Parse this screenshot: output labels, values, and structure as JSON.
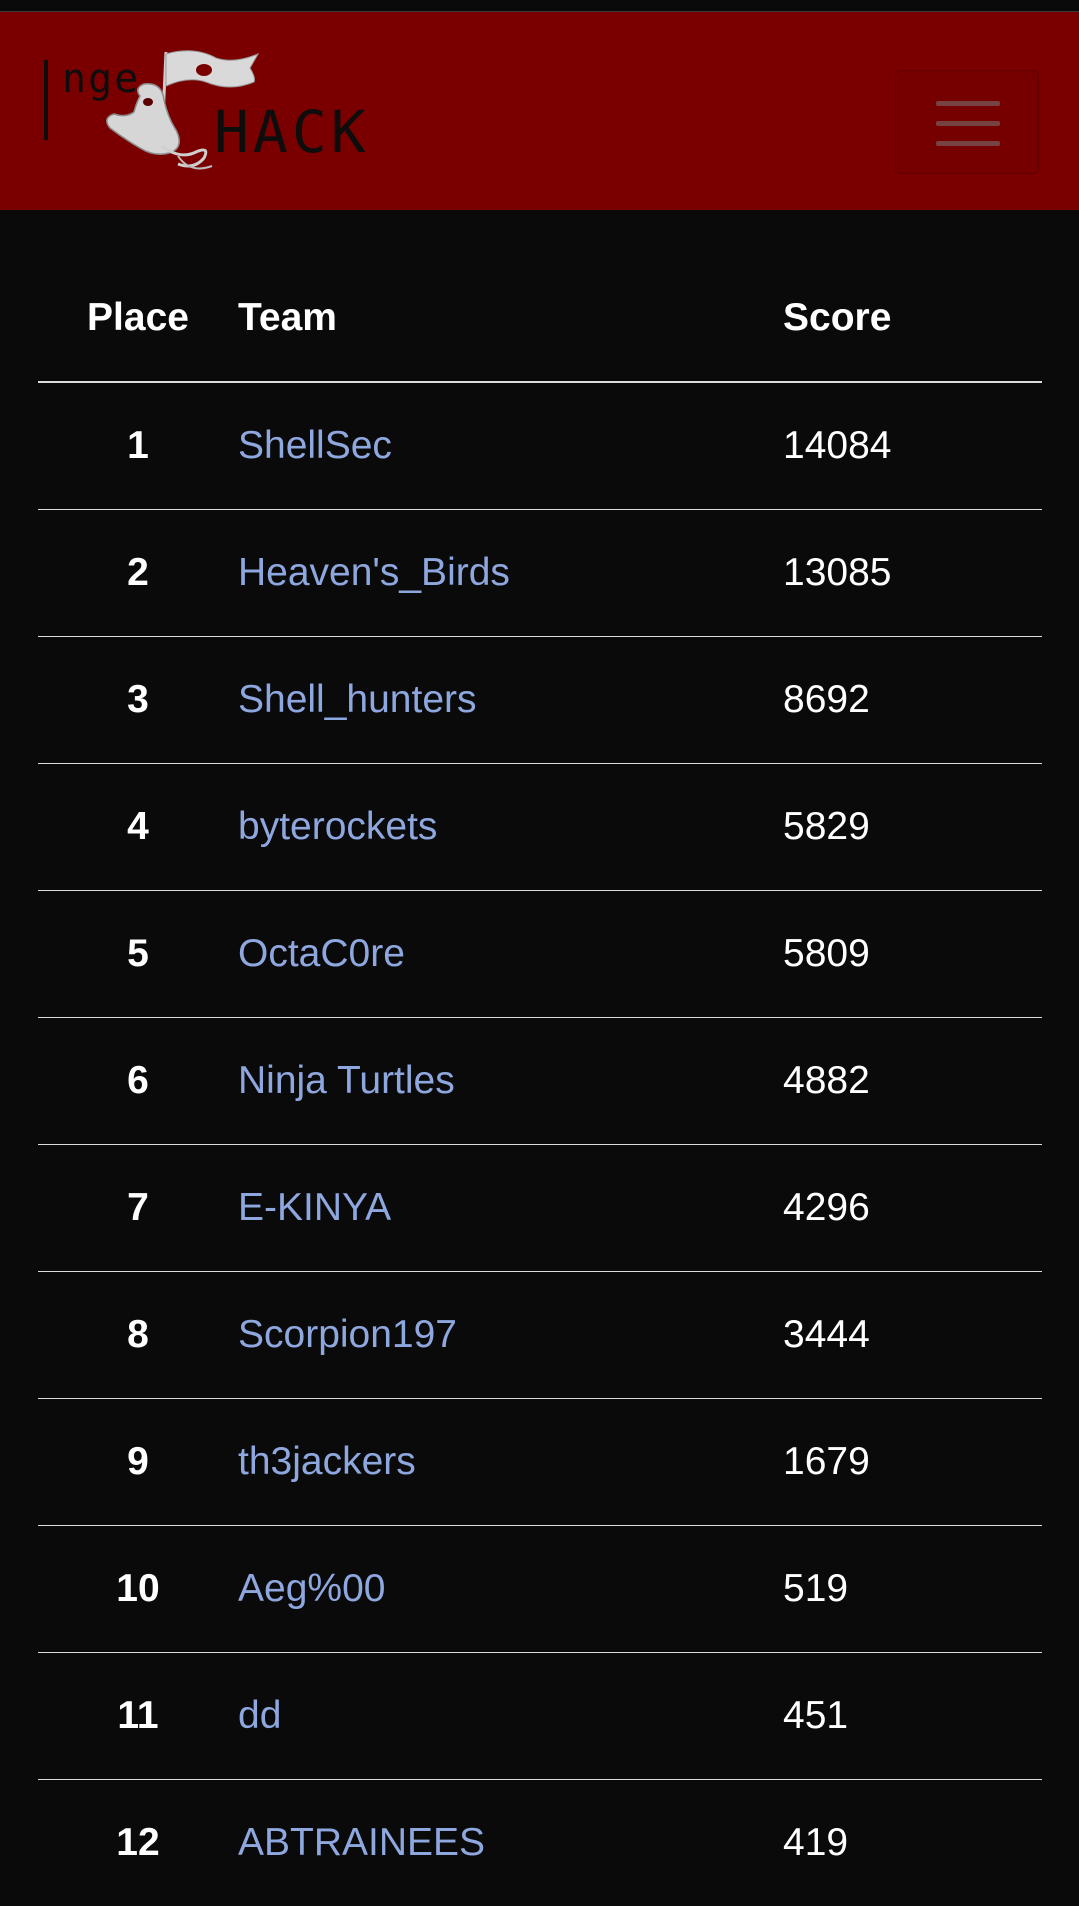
{
  "navbar": {
    "logo_small": "nge",
    "logo_big": "HACK",
    "brand_color": "#7a0000",
    "toggler_icon": "hamburger-icon"
  },
  "scoreboard": {
    "headers": {
      "place": "Place",
      "team": "Team",
      "score": "Score"
    },
    "link_color": "#8ea8df",
    "rows": [
      {
        "place": "1",
        "team": "ShellSec",
        "score": "14084"
      },
      {
        "place": "2",
        "team": "Heaven's_Birds",
        "score": "13085"
      },
      {
        "place": "3",
        "team": "Shell_hunters",
        "score": "8692"
      },
      {
        "place": "4",
        "team": "byterockets",
        "score": "5829"
      },
      {
        "place": "5",
        "team": "OctaC0re",
        "score": "5809"
      },
      {
        "place": "6",
        "team": "Ninja Turtles",
        "score": "4882"
      },
      {
        "place": "7",
        "team": "E-KINYA",
        "score": "4296"
      },
      {
        "place": "8",
        "team": "Scorpion197",
        "score": "3444"
      },
      {
        "place": "9",
        "team": "th3jackers",
        "score": "1679"
      },
      {
        "place": "10",
        "team": "Aeg%00",
        "score": "519"
      },
      {
        "place": "11",
        "team": "dd",
        "score": "451"
      },
      {
        "place": "12",
        "team": "ABTRAINEES",
        "score": "419"
      }
    ]
  }
}
